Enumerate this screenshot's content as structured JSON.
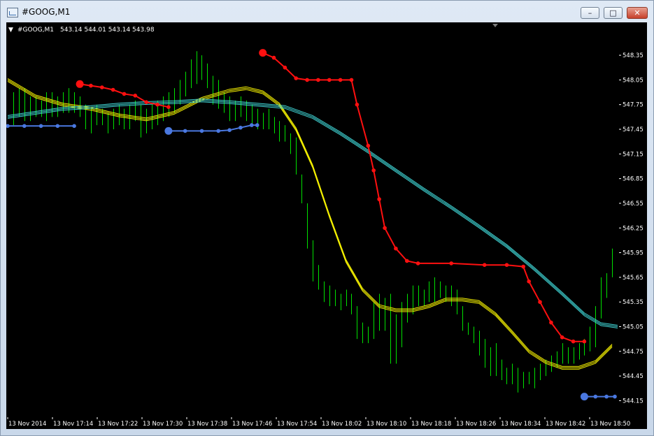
{
  "window": {
    "title": "#GOOG,M1"
  },
  "title_buttons": {
    "minimize": "–",
    "maximize": "□",
    "close": "✕"
  },
  "chart_info": {
    "symbol_label": "#GOOG,M1",
    "ohlc_text": "543.14 544.01 543.14 543.98"
  },
  "colors": {
    "background": "#000000",
    "bars": "#00e000",
    "yellow_ma": "#f4f000",
    "cyan_ma": "#3fd4d4",
    "sar_red": "#ff1010",
    "sar_blue": "#4a78e0",
    "axis_text": "#ffffff"
  },
  "chart_data": {
    "type": "line",
    "y_axis": {
      "ylim": [
        543.95,
        548.75
      ],
      "tick_labels": [
        "548.35",
        "548.05",
        "547.75",
        "547.45",
        "547.15",
        "546.85",
        "546.55",
        "546.25",
        "545.95",
        "545.65",
        "545.35",
        "545.05",
        "544.75",
        "544.45",
        "544.15"
      ]
    },
    "x_axis": {
      "xlim": [
        0,
        110
      ],
      "tick_labels": [
        "13 Nov 2014",
        "13 Nov 17:14",
        "13 Nov 17:22",
        "13 Nov 17:30",
        "13 Nov 17:38",
        "13 Nov 17:46",
        "13 Nov 17:54",
        "13 Nov 18:02",
        "13 Nov 18:10",
        "13 Nov 18:18",
        "13 Nov 18:26",
        "13 Nov 18:34",
        "13 Nov 18:42",
        "13 Nov 18:50"
      ]
    },
    "price_bars": [
      {
        "x": 1,
        "high": 547.9,
        "low": 547.5
      },
      {
        "x": 2,
        "high": 547.95,
        "low": 547.6
      },
      {
        "x": 3,
        "high": 547.95,
        "low": 547.55
      },
      {
        "x": 4,
        "high": 547.85,
        "low": 547.55
      },
      {
        "x": 5,
        "high": 547.85,
        "low": 547.6
      },
      {
        "x": 6,
        "high": 547.8,
        "low": 547.6
      },
      {
        "x": 7,
        "high": 547.9,
        "low": 547.55
      },
      {
        "x": 8,
        "high": 547.9,
        "low": 547.6
      },
      {
        "x": 9,
        "high": 547.85,
        "low": 547.6
      },
      {
        "x": 10,
        "high": 547.9,
        "low": 547.65
      },
      {
        "x": 11,
        "high": 547.95,
        "low": 547.65
      },
      {
        "x": 12,
        "high": 547.9,
        "low": 547.65
      },
      {
        "x": 13,
        "high": 547.85,
        "low": 547.6
      },
      {
        "x": 14,
        "high": 547.75,
        "low": 547.45
      },
      {
        "x": 15,
        "high": 547.7,
        "low": 547.4
      },
      {
        "x": 16,
        "high": 547.75,
        "low": 547.5
      },
      {
        "x": 17,
        "high": 547.7,
        "low": 547.5
      },
      {
        "x": 18,
        "high": 547.65,
        "low": 547.4
      },
      {
        "x": 19,
        "high": 547.7,
        "low": 547.45
      },
      {
        "x": 20,
        "high": 547.75,
        "low": 547.5
      },
      {
        "x": 21,
        "high": 547.7,
        "low": 547.45
      },
      {
        "x": 22,
        "high": 547.75,
        "low": 547.45
      },
      {
        "x": 23,
        "high": 547.8,
        "low": 547.55
      },
      {
        "x": 24,
        "high": 547.75,
        "low": 547.35
      },
      {
        "x": 25,
        "high": 547.7,
        "low": 547.4
      },
      {
        "x": 26,
        "high": 547.75,
        "low": 547.45
      },
      {
        "x": 27,
        "high": 547.8,
        "low": 547.5
      },
      {
        "x": 28,
        "high": 547.85,
        "low": 547.55
      },
      {
        "x": 29,
        "high": 547.9,
        "low": 547.6
      },
      {
        "x": 30,
        "high": 547.95,
        "low": 547.65
      },
      {
        "x": 31,
        "high": 548.05,
        "low": 547.75
      },
      {
        "x": 32,
        "high": 548.15,
        "low": 547.85
      },
      {
        "x": 33,
        "high": 548.3,
        "low": 547.95
      },
      {
        "x": 34,
        "high": 548.4,
        "low": 548.0
      },
      {
        "x": 35,
        "high": 548.35,
        "low": 548.05
      },
      {
        "x": 36,
        "high": 548.25,
        "low": 547.95
      },
      {
        "x": 37,
        "high": 548.1,
        "low": 547.75
      },
      {
        "x": 38,
        "high": 548.05,
        "low": 547.7
      },
      {
        "x": 39,
        "high": 547.9,
        "low": 547.65
      },
      {
        "x": 40,
        "high": 547.85,
        "low": 547.55
      },
      {
        "x": 41,
        "high": 547.8,
        "low": 547.55
      },
      {
        "x": 42,
        "high": 547.85,
        "low": 547.6
      },
      {
        "x": 43,
        "high": 547.8,
        "low": 547.55
      },
      {
        "x": 44,
        "high": 547.75,
        "low": 547.5
      },
      {
        "x": 45,
        "high": 547.7,
        "low": 547.45
      },
      {
        "x": 46,
        "high": 547.65,
        "low": 547.45
      },
      {
        "x": 47,
        "high": 547.7,
        "low": 547.45
      },
      {
        "x": 48,
        "high": 547.6,
        "low": 547.4
      },
      {
        "x": 49,
        "high": 547.55,
        "low": 547.3
      },
      {
        "x": 50,
        "high": 547.5,
        "low": 547.3
      },
      {
        "x": 51,
        "high": 547.4,
        "low": 547.15
      },
      {
        "x": 52,
        "high": 547.35,
        "low": 546.9
      },
      {
        "x": 53,
        "high": 546.9,
        "low": 546.55
      },
      {
        "x": 54,
        "high": 546.55,
        "low": 546.0
      },
      {
        "x": 55,
        "high": 546.1,
        "low": 545.6
      },
      {
        "x": 56,
        "high": 545.8,
        "low": 545.5
      },
      {
        "x": 57,
        "high": 545.6,
        "low": 545.35
      },
      {
        "x": 58,
        "high": 545.55,
        "low": 545.3
      },
      {
        "x": 59,
        "high": 545.5,
        "low": 545.3
      },
      {
        "x": 60,
        "high": 545.45,
        "low": 545.25
      },
      {
        "x": 61,
        "high": 545.5,
        "low": 545.3
      },
      {
        "x": 62,
        "high": 545.45,
        "low": 545.2
      },
      {
        "x": 63,
        "high": 545.3,
        "low": 544.9
      },
      {
        "x": 64,
        "high": 545.1,
        "low": 544.85
      },
      {
        "x": 65,
        "high": 545.05,
        "low": 544.85
      },
      {
        "x": 66,
        "high": 545.35,
        "low": 544.9
      },
      {
        "x": 67,
        "high": 545.45,
        "low": 545.0
      },
      {
        "x": 68,
        "high": 545.4,
        "low": 545.0
      },
      {
        "x": 69,
        "high": 545.45,
        "low": 544.6
      },
      {
        "x": 70,
        "high": 545.2,
        "low": 544.6
      },
      {
        "x": 71,
        "high": 545.35,
        "low": 544.8
      },
      {
        "x": 72,
        "high": 545.45,
        "low": 545.1
      },
      {
        "x": 73,
        "high": 545.55,
        "low": 545.2
      },
      {
        "x": 74,
        "high": 545.55,
        "low": 545.3
      },
      {
        "x": 75,
        "high": 545.5,
        "low": 545.3
      },
      {
        "x": 76,
        "high": 545.6,
        "low": 545.35
      },
      {
        "x": 77,
        "high": 545.65,
        "low": 545.35
      },
      {
        "x": 78,
        "high": 545.6,
        "low": 545.4
      },
      {
        "x": 79,
        "high": 545.55,
        "low": 545.35
      },
      {
        "x": 80,
        "high": 545.55,
        "low": 545.3
      },
      {
        "x": 81,
        "high": 545.5,
        "low": 545.2
      },
      {
        "x": 82,
        "high": 545.3,
        "low": 545.0
      },
      {
        "x": 83,
        "high": 545.1,
        "low": 544.95
      },
      {
        "x": 84,
        "high": 545.05,
        "low": 544.85
      },
      {
        "x": 85,
        "high": 545.0,
        "low": 544.7
      },
      {
        "x": 86,
        "high": 544.9,
        "low": 544.55
      },
      {
        "x": 87,
        "high": 544.8,
        "low": 544.45
      },
      {
        "x": 88,
        "high": 544.85,
        "low": 544.45
      },
      {
        "x": 89,
        "high": 544.65,
        "low": 544.4
      },
      {
        "x": 90,
        "high": 544.55,
        "low": 544.35
      },
      {
        "x": 91,
        "high": 544.6,
        "low": 544.35
      },
      {
        "x": 92,
        "high": 544.55,
        "low": 544.25
      },
      {
        "x": 93,
        "high": 544.5,
        "low": 544.3
      },
      {
        "x": 94,
        "high": 544.5,
        "low": 544.35
      },
      {
        "x": 95,
        "high": 544.55,
        "low": 544.3
      },
      {
        "x": 96,
        "high": 544.6,
        "low": 544.4
      },
      {
        "x": 97,
        "high": 544.65,
        "low": 544.45
      },
      {
        "x": 98,
        "high": 544.7,
        "low": 544.5
      },
      {
        "x": 99,
        "high": 544.75,
        "low": 544.55
      },
      {
        "x": 100,
        "high": 544.85,
        "low": 544.6
      },
      {
        "x": 101,
        "high": 544.8,
        "low": 544.6
      },
      {
        "x": 102,
        "high": 544.8,
        "low": 544.6
      },
      {
        "x": 103,
        "high": 544.85,
        "low": 544.65
      },
      {
        "x": 104,
        "high": 544.9,
        "low": 544.7
      },
      {
        "x": 105,
        "high": 545.05,
        "low": 544.75
      },
      {
        "x": 106,
        "high": 545.3,
        "low": 544.8
      },
      {
        "x": 107,
        "high": 545.65,
        "low": 545.15
      },
      {
        "x": 108,
        "high": 545.7,
        "low": 545.4
      },
      {
        "x": 109,
        "high": 546.0,
        "low": 545.65
      }
    ],
    "series": [
      {
        "style": "triple_line",
        "color": "#f4f000",
        "points": [
          [
            0,
            548.05
          ],
          [
            5,
            547.85
          ],
          [
            10,
            547.75
          ],
          [
            15,
            547.7
          ],
          [
            20,
            547.62
          ],
          [
            25,
            547.57
          ],
          [
            30,
            547.65
          ],
          [
            35,
            547.82
          ],
          [
            40,
            547.92
          ],
          [
            43,
            547.95
          ],
          [
            46,
            547.9
          ],
          [
            49,
            547.75
          ],
          [
            52,
            547.45
          ],
          [
            55,
            547.0
          ],
          [
            58,
            546.4
          ],
          [
            61,
            545.85
          ],
          [
            64,
            545.5
          ],
          [
            67,
            545.3
          ],
          [
            70,
            545.25
          ],
          [
            73,
            545.25
          ],
          [
            76,
            545.3
          ],
          [
            79,
            545.38
          ],
          [
            82,
            545.38
          ],
          [
            85,
            545.35
          ],
          [
            88,
            545.2
          ],
          [
            91,
            544.98
          ],
          [
            94,
            544.75
          ],
          [
            97,
            544.62
          ],
          [
            100,
            544.55
          ],
          [
            103,
            544.55
          ],
          [
            106,
            544.62
          ],
          [
            109,
            544.82
          ]
        ]
      },
      {
        "style": "triple_line",
        "color": "#3fd4d4",
        "points": [
          [
            0,
            547.6
          ],
          [
            5,
            547.65
          ],
          [
            10,
            547.7
          ],
          [
            15,
            547.72
          ],
          [
            20,
            547.75
          ],
          [
            25,
            547.77
          ],
          [
            30,
            547.78
          ],
          [
            35,
            547.8
          ],
          [
            40,
            547.78
          ],
          [
            45,
            547.75
          ],
          [
            50,
            547.72
          ],
          [
            55,
            547.6
          ],
          [
            60,
            547.4
          ],
          [
            65,
            547.18
          ],
          [
            70,
            546.95
          ],
          [
            75,
            546.72
          ],
          [
            80,
            546.5
          ],
          [
            85,
            546.27
          ],
          [
            90,
            546.03
          ],
          [
            95,
            545.75
          ],
          [
            100,
            545.45
          ],
          [
            104,
            545.2
          ],
          [
            107,
            545.08
          ],
          [
            110,
            545.05
          ]
        ]
      },
      {
        "style": "dots",
        "color": "#ff1010",
        "start_marker": true,
        "points": [
          [
            13,
            548.0
          ],
          [
            15,
            547.98
          ],
          [
            17,
            547.96
          ],
          [
            19,
            547.93
          ],
          [
            21,
            547.88
          ],
          [
            23,
            547.86
          ],
          [
            25,
            547.78
          ],
          [
            27,
            547.75
          ],
          [
            29,
            547.72
          ]
        ]
      },
      {
        "style": "dots",
        "color": "#ff1010",
        "start_marker": true,
        "points": [
          [
            46,
            548.38
          ],
          [
            48,
            548.32
          ],
          [
            50,
            548.2
          ],
          [
            52,
            548.07
          ],
          [
            54,
            548.05
          ],
          [
            56,
            548.05
          ],
          [
            58,
            548.05
          ],
          [
            60,
            548.05
          ],
          [
            62,
            548.05
          ],
          [
            63,
            547.75
          ],
          [
            65,
            547.25
          ],
          [
            66,
            546.95
          ],
          [
            67,
            546.6
          ],
          [
            68,
            546.25
          ],
          [
            70,
            546.0
          ],
          [
            72,
            545.85
          ],
          [
            74,
            545.82
          ],
          [
            80,
            545.82
          ],
          [
            86,
            545.8
          ],
          [
            90,
            545.8
          ],
          [
            93,
            545.78
          ],
          [
            94,
            545.6
          ],
          [
            96,
            545.35
          ],
          [
            98,
            545.1
          ],
          [
            100,
            544.92
          ],
          [
            102,
            544.87
          ],
          [
            104,
            544.87
          ]
        ]
      },
      {
        "style": "dots",
        "color": "#4a78e0",
        "start_marker": false,
        "points": [
          [
            0,
            547.49
          ],
          [
            3,
            547.49
          ],
          [
            6,
            547.49
          ],
          [
            9,
            547.49
          ],
          [
            12,
            547.49
          ]
        ]
      },
      {
        "style": "dots",
        "color": "#4a78e0",
        "start_marker": true,
        "points": [
          [
            29,
            547.43
          ],
          [
            32,
            547.43
          ],
          [
            35,
            547.43
          ],
          [
            38,
            547.43
          ],
          [
            40,
            547.44
          ],
          [
            42,
            547.47
          ],
          [
            44,
            547.5
          ],
          [
            45,
            547.5
          ]
        ]
      },
      {
        "style": "dots",
        "color": "#4a78e0",
        "start_marker": true,
        "points": [
          [
            104,
            544.2
          ],
          [
            106,
            544.2
          ],
          [
            108,
            544.2
          ],
          [
            109.5,
            544.2
          ]
        ]
      }
    ]
  }
}
